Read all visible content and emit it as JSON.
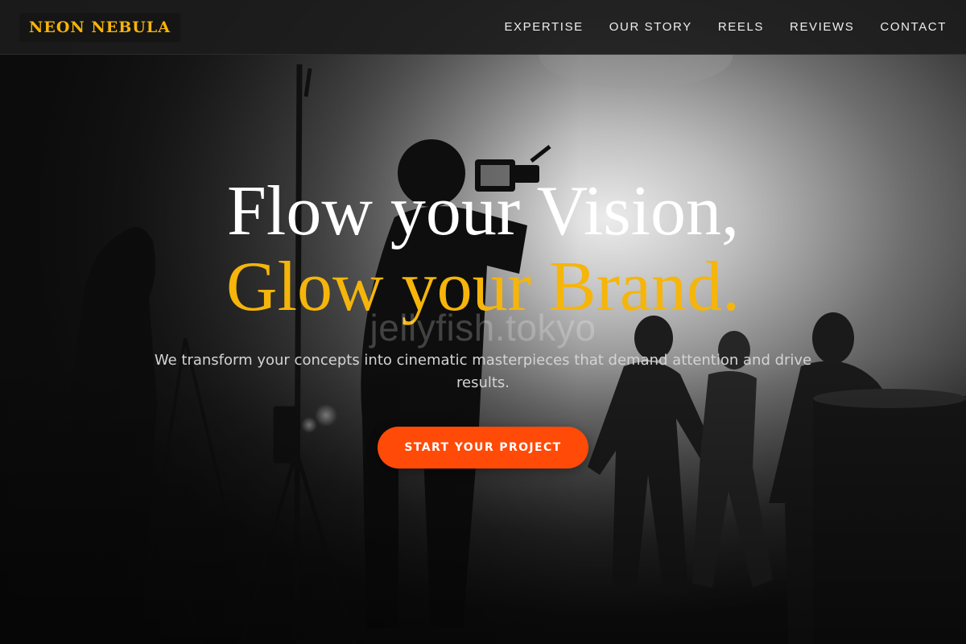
{
  "brand": {
    "logo_text": "NEON NEBULA",
    "accent_color": "#f5b50a",
    "cta_color": "#ff4a08"
  },
  "nav": {
    "items": [
      {
        "label": "EXPERTISE"
      },
      {
        "label": "OUR STORY"
      },
      {
        "label": "REELS"
      },
      {
        "label": "REVIEWS"
      },
      {
        "label": "CONTACT"
      }
    ]
  },
  "hero": {
    "title_line1": "Flow your Vision,",
    "title_line2": "Glow your Brand.",
    "watermark": "jellyfish.tokyo",
    "subtitle": "We transform your concepts into cinematic masterpieces that demand attention and drive results.",
    "cta_label": "START YOUR PROJECT",
    "background_description_icon": "film-set-photo"
  }
}
